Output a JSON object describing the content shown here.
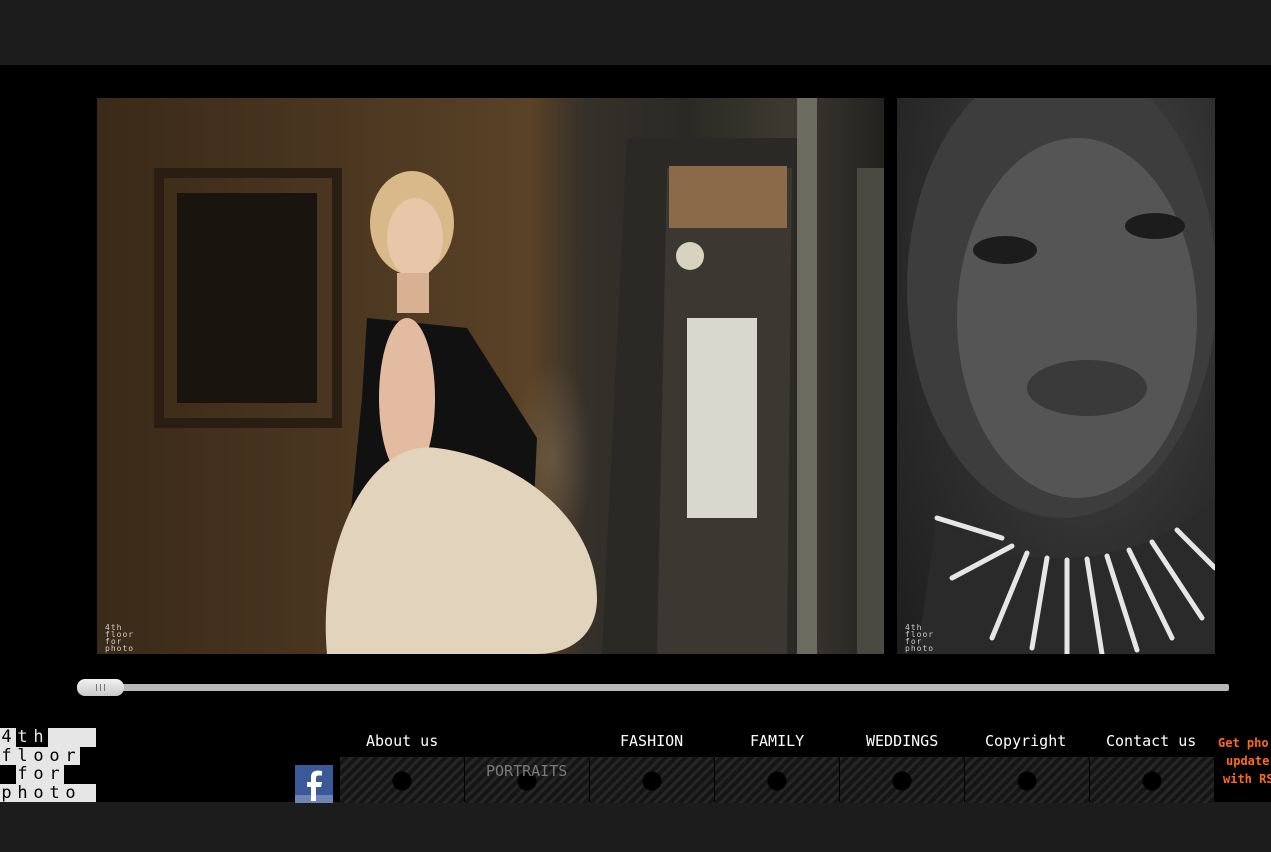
{
  "brand": {
    "logo_lines": [
      "4th",
      "floor",
      "for",
      "photo"
    ],
    "watermark": "4th\nfloor\nfor\nphoto"
  },
  "gallery": {
    "photos": [
      {
        "name": "vintage-fashion-portrait"
      },
      {
        "name": "necklace-close-portrait"
      }
    ],
    "slider": {
      "position": 0
    }
  },
  "nav": {
    "about": "About us",
    "portraits": "PORTRAITS",
    "fashion": "FASHION",
    "family": "FAMILY",
    "weddings": "WEDDINGS",
    "copyright": "Copyright",
    "contact": "Contact us",
    "rss_lines": [
      "Get pho",
      "update",
      "with RS"
    ]
  },
  "colors": {
    "background": "#1c1c1c",
    "accent_rss": "#ff6a1a",
    "facebook": "#3b5998"
  },
  "icons": [
    "facebook-icon",
    "slider-grip-icon"
  ]
}
